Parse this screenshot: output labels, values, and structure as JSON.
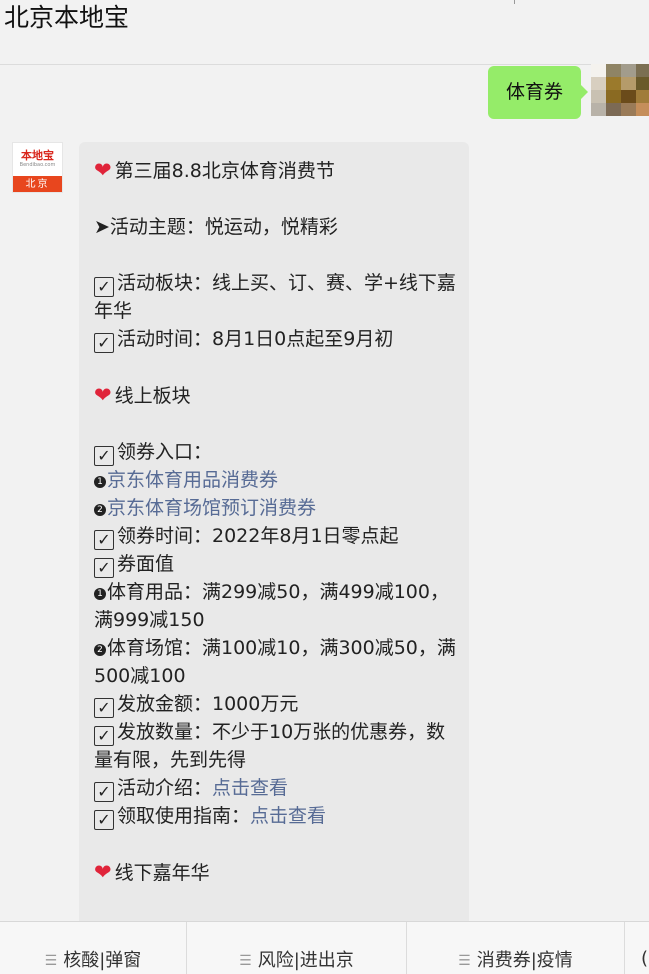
{
  "header": {
    "title": "北京本地宝"
  },
  "outgoing": {
    "text": "体育券"
  },
  "logo": {
    "brand": "本地宝",
    "sub": "Bendibao.com",
    "city": "北京"
  },
  "message": {
    "title": "第三届8.8北京体育消费节",
    "theme": "➤活动主题：悦运动，悦精彩",
    "blocks": "活动板块：线上买、订、赛、学+线下嘉年华",
    "time": "活动时间：8月1日0点起至9月初",
    "online_heading": "线上板块",
    "entry": "领券入口：",
    "link1": "京东体育用品消费券",
    "link2": "京东体育场馆预订消费券",
    "coupon_time": "领券时间：2022年8月1日零点起",
    "face_value": "券面值",
    "goods": "体育用品：满299减50，满499减100，满999减150",
    "venue": "体育场馆：满100减10，满300减50，满500减100",
    "amount": "发放金额：1000万元",
    "quantity": "发放数量：不少于10万张的优惠券，数量有限，先到先得",
    "intro_label": "活动介绍：",
    "intro_link": "点击查看",
    "guide_label": "领取使用指南：",
    "guide_link": "点击查看",
    "offline_heading": "线下嘉年华"
  },
  "bottom_tabs": [
    {
      "label": "核酸|弹窗"
    },
    {
      "label": "风险|进出京"
    },
    {
      "label": "消费券|疫情"
    }
  ],
  "colors": {
    "accent_green": "#95ec69",
    "link": "#576b95",
    "heart": "#e0243a"
  }
}
